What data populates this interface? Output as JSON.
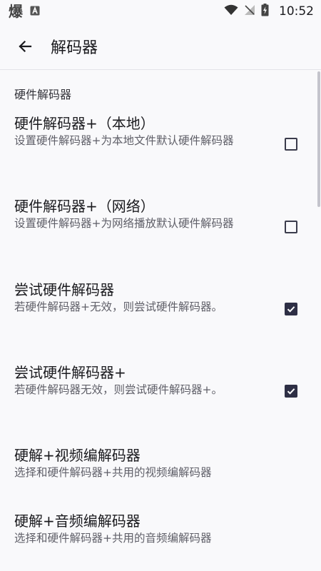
{
  "status_bar": {
    "app_glyph": "爆",
    "time": "10:52",
    "icons": [
      "app-notification-icon",
      "a-notification-icon",
      "wifi-icon",
      "no-signal-icon",
      "battery-icon"
    ]
  },
  "app_bar": {
    "back_icon": "arrow-left-icon",
    "title": "解码器"
  },
  "section": {
    "header": "硬件解码器"
  },
  "prefs": [
    {
      "title": "硬件解码器+（本地）",
      "summary": "设置硬件解码器+为本地文件默认硬件解码器",
      "checked": false
    },
    {
      "title": "硬件解码器+（网络）",
      "summary": "设置硬件解码器+为网络播放默认硬件解码器",
      "checked": false
    },
    {
      "title": "尝试硬件解码器",
      "summary": "若硬件解码器+无效，则尝试硬件解码器。",
      "checked": true
    },
    {
      "title": "尝试硬件解码器+",
      "summary": "若硬件解码器无效，则尝试硬件解码器+。",
      "checked": true
    },
    {
      "title": "硬解+视频编解码器",
      "summary": "选择和硬件解码器+共用的视频编解码器"
    },
    {
      "title": "硬解+音频编解码器",
      "summary": "选择和硬件解码器+共用的音频编解码器"
    }
  ],
  "colors": {
    "background": "#f9f9fb",
    "text_primary": "#1b1b1f",
    "text_secondary": "#5f5f68",
    "checkbox_checked": "#2e2f45"
  }
}
